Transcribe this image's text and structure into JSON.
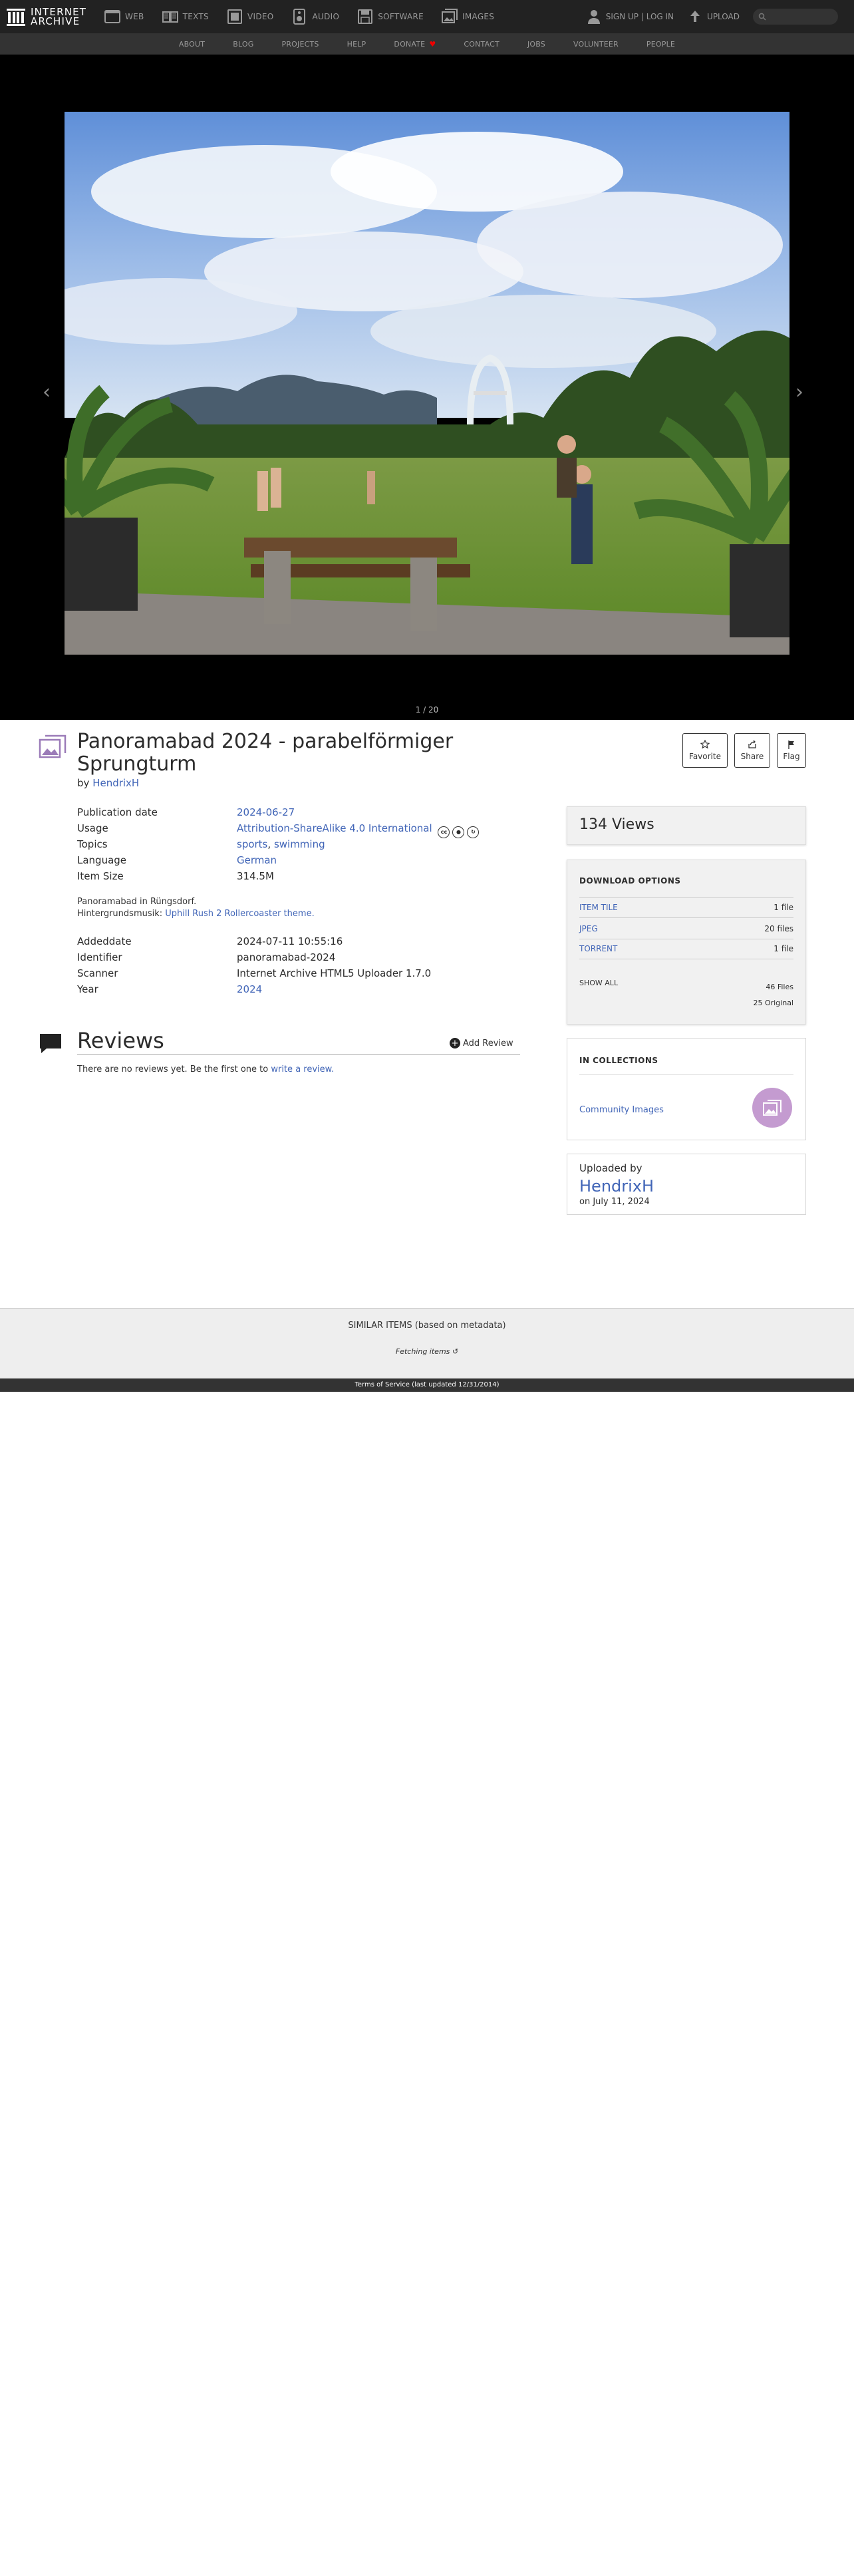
{
  "topnav": {
    "logo_line1": "INTERNET",
    "logo_line2": "ARCHIVE",
    "media": [
      {
        "label": "WEB",
        "icon": "web-icon"
      },
      {
        "label": "TEXTS",
        "icon": "book-icon"
      },
      {
        "label": "VIDEO",
        "icon": "film-icon"
      },
      {
        "label": "AUDIO",
        "icon": "speaker-icon"
      },
      {
        "label": "SOFTWARE",
        "icon": "floppy-icon"
      },
      {
        "label": "IMAGES",
        "icon": "images-icon"
      }
    ],
    "signup": "SIGN UP | LOG IN",
    "upload": "UPLOAD"
  },
  "subnav": [
    "ABOUT",
    "BLOG",
    "PROJECTS",
    "HELP",
    "DONATE",
    "CONTACT",
    "JOBS",
    "VOLUNTEER",
    "PEOPLE"
  ],
  "theater": {
    "counter": "1 / 20",
    "prev_icon": "chevron-left-icon",
    "next_icon": "chevron-right-icon"
  },
  "item": {
    "title": "Panoramabad 2024 - parabelförmiger Sprungturm",
    "by_label": "by",
    "creator": "HendrixH",
    "actions": {
      "favorite": "Favorite",
      "share": "Share",
      "flag": "Flag"
    },
    "meta": {
      "publication_date_label": "Publication date",
      "publication_date": "2024-06-27",
      "usage_label": "Usage",
      "usage": "Attribution-ShareAlike 4.0 International",
      "topics_label": "Topics",
      "topic1": "sports",
      "topic2": "swimming",
      "language_label": "Language",
      "language": "German",
      "item_size_label": "Item Size",
      "item_size": "314.5M"
    },
    "description_line1": "Panoramabad in Rüngsdorf.",
    "description_line2_prefix": "Hintergrundsmusik:",
    "description_line2_link": "Uphill Rush 2 Rollercoaster theme.",
    "meta2": {
      "addeddate_label": "Addeddate",
      "addeddate": "2024-07-11 10:55:16",
      "identifier_label": "Identifier",
      "identifier": "panoramabad-2024",
      "scanner_label": "Scanner",
      "scanner": "Internet Archive HTML5 Uploader 1.7.0",
      "year_label": "Year",
      "year": "2024"
    }
  },
  "reviews": {
    "title": "Reviews",
    "add": "Add Review",
    "empty_prefix": "There are no reviews yet. Be the first one to",
    "empty_link": "write a review."
  },
  "sidebar": {
    "views": "134 Views",
    "downloads": {
      "title": "DOWNLOAD OPTIONS",
      "rows": [
        {
          "label": "ITEM TILE",
          "count": "1 file"
        },
        {
          "label": "JPEG",
          "count": "20 files"
        },
        {
          "label": "TORRENT",
          "count": "1 file"
        }
      ],
      "show_all": "SHOW ALL",
      "total_files": "46 Files",
      "original": "25 Original"
    },
    "collections": {
      "title": "IN COLLECTIONS",
      "item": "Community Images"
    },
    "uploader": {
      "label": "Uploaded by",
      "name": "HendrixH",
      "date": "on July 11, 2024"
    }
  },
  "similar": {
    "title": "SIMILAR ITEMS (based on metadata)",
    "fetching": "Fetching items"
  },
  "footer": "Terms of Service (last updated 12/31/2014)",
  "colors": {
    "link": "#4165b7",
    "topbar": "#222222",
    "subbar": "#333333",
    "collection_thumb": "#c49bd0"
  }
}
